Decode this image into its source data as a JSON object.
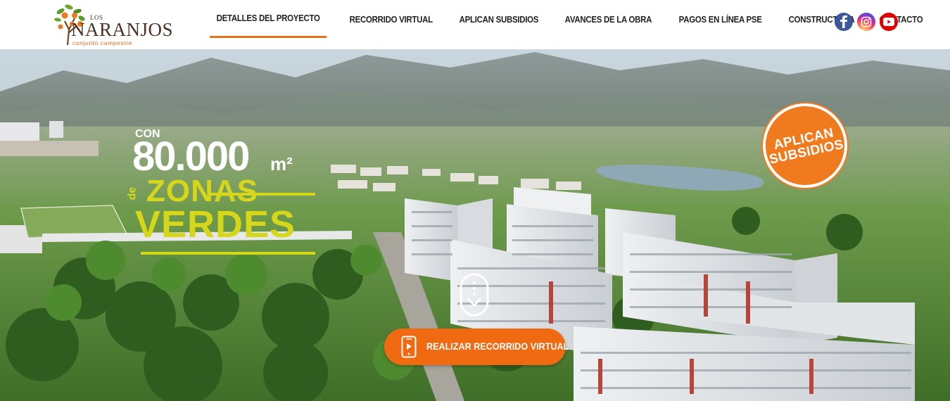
{
  "brand": {
    "logo_small": "LOS",
    "logo_name": "NARANJOS",
    "logo_sub": "conjunto campestre"
  },
  "nav": {
    "items": [
      {
        "label": "DETALLES DEL PROYECTO",
        "active": true
      },
      {
        "label": "RECORRIDO VIRTUAL",
        "active": false
      },
      {
        "label": "APLICAN SUBSIDIOS",
        "active": false
      },
      {
        "label": "AVANCES DE LA OBRA",
        "active": false
      },
      {
        "label": "PAGOS EN LÍNEA PSE",
        "active": false
      },
      {
        "label": "CONSTRUCTORA",
        "active": false
      },
      {
        "label": "CONTACTO",
        "active": false
      }
    ],
    "accent_color": "#e8701e"
  },
  "social": {
    "icons": [
      "facebook-icon",
      "instagram-icon",
      "youtube-icon"
    ]
  },
  "hero": {
    "promo": {
      "prefix": "CON",
      "number": "80.000",
      "unit": "m²",
      "connector": "de",
      "line1": "ZONAS",
      "line2": "VERDES"
    },
    "badge": {
      "line1": "APLICAN",
      "line2": "SUBSIDIOS"
    },
    "cta": {
      "label": "REALIZAR RECORRIDO VIRTUAL",
      "icon": "phone-play-icon"
    },
    "scroll_icon": "scroll-down-icon",
    "colors": {
      "orange": "#f06a12",
      "yellow_green": "#d6d61a"
    }
  }
}
